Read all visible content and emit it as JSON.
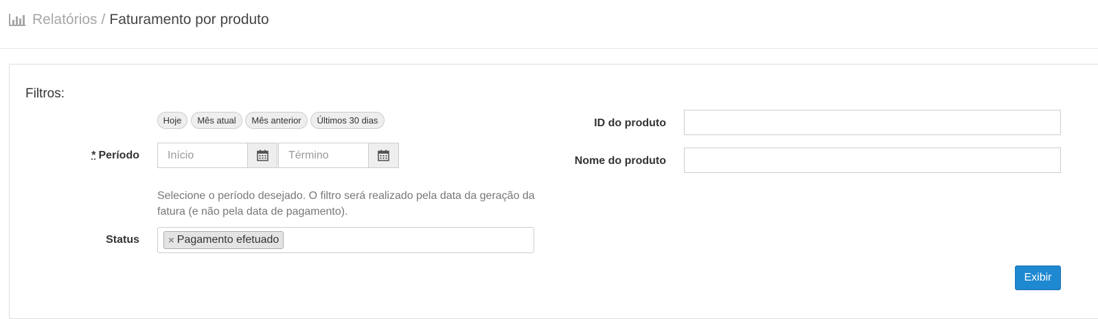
{
  "header": {
    "icon": "bar-chart-icon",
    "breadcrumb": {
      "parent": "Relatórios",
      "separator": "/",
      "current": "Faturamento por produto"
    }
  },
  "filters": {
    "title": "Filtros:",
    "quick_ranges": [
      "Hoje",
      "Mês atual",
      "Mês anterior",
      "Últimos 30 dias"
    ],
    "period": {
      "required_mark": "*",
      "label": "Período",
      "start_placeholder": "Início",
      "end_placeholder": "Término",
      "calendar_icon": "calendar-icon",
      "help": "Selecione o período desejado. O filtro será realizado pela data da geração da fatura (e não pela data de pagamento)."
    },
    "status": {
      "label": "Status",
      "selected": [
        {
          "remove": "×",
          "label": "Pagamento efetuado"
        }
      ]
    },
    "product_id": {
      "label": "ID do produto",
      "value": ""
    },
    "product_name": {
      "label": "Nome do produto",
      "value": ""
    },
    "submit_label": "Exibir"
  },
  "colors": {
    "primary_button": "#1e88d0",
    "muted_text": "#777777"
  }
}
